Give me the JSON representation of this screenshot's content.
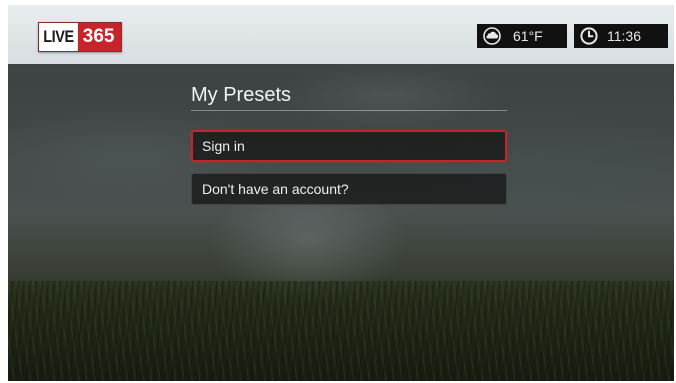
{
  "app": {
    "logo_left": "LIVE",
    "logo_right": "365",
    "brand_color": "#c8222a"
  },
  "status": {
    "weather_icon": "cloud-icon",
    "temperature": "61°F",
    "clock_icon": "clock-icon",
    "time": "11:36"
  },
  "menu": {
    "title": "My Presets",
    "items": [
      {
        "label": "Sign in",
        "selected": true
      },
      {
        "label": "Don't have an account?",
        "selected": false
      }
    ]
  },
  "colors": {
    "highlight": "#c4252d",
    "top_bar": "#e1e6e8"
  }
}
